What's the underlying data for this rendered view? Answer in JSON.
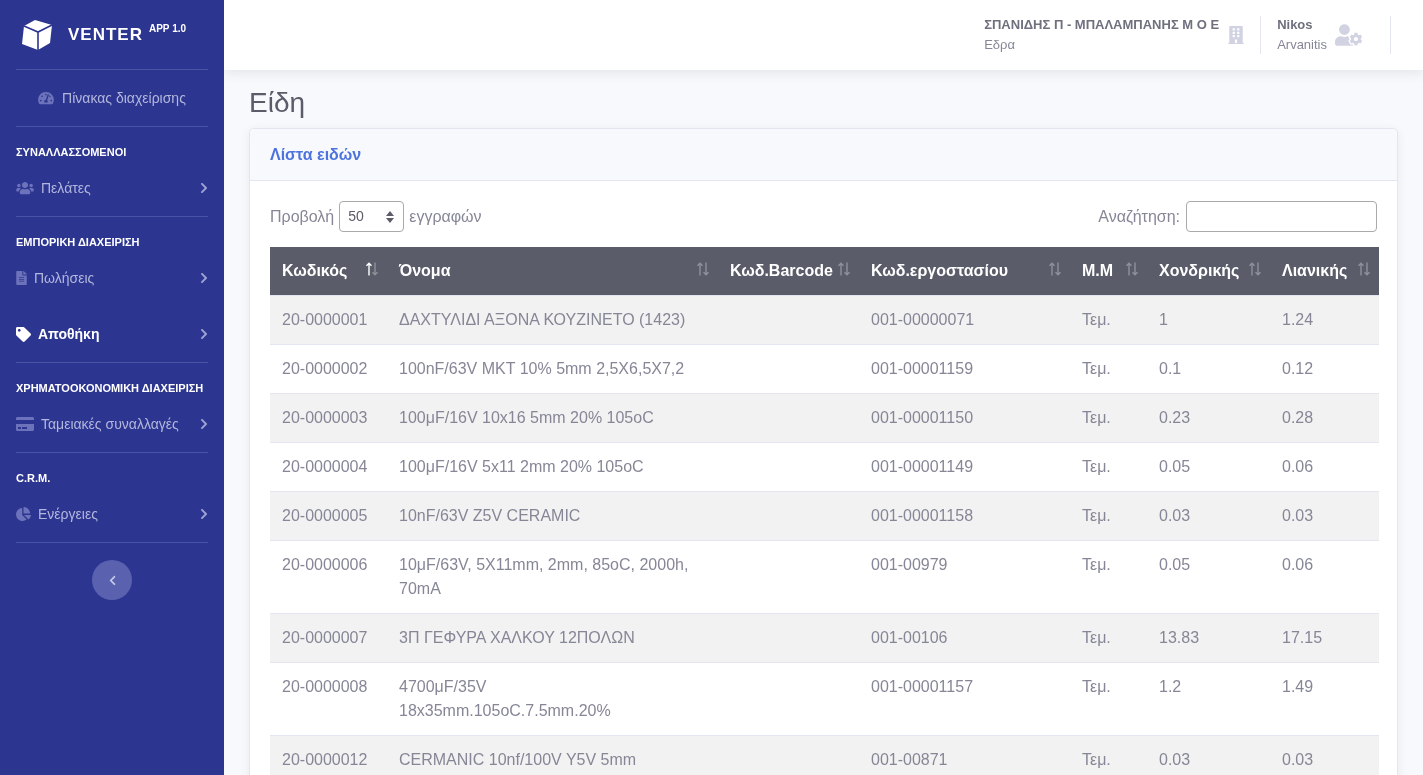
{
  "sidebar": {
    "brand": {
      "name": "VENTER",
      "version": "APP 1.0"
    },
    "dashboard": {
      "label": "Πίνακας διαχείρισης"
    },
    "sections": [
      {
        "heading": "ΣΥΝΑΛΛΑΣΣΟΜΕΝΟΙ",
        "items": [
          {
            "label": "Πελάτες",
            "selected": false
          }
        ]
      },
      {
        "heading": "ΕΜΠΟΡΙΚΗ ΔΙΑΧΕΙΡΙΣΗ",
        "items": [
          {
            "label": "Πωλήσεις",
            "selected": false
          },
          {
            "label": "Αποθήκη",
            "selected": true
          }
        ]
      },
      {
        "heading": "ΧΡΗΜΑΤΟΟΚΟΝΟΜΙΚΗ ΔΙΑΧΕΙΡΙΣΗ",
        "items": [
          {
            "label": "Ταμειακές συναλλαγές",
            "selected": false
          }
        ]
      },
      {
        "heading": "C.R.M.",
        "items": [
          {
            "label": "Ενέργειες",
            "selected": false
          }
        ]
      }
    ]
  },
  "top_bar": {
    "company": {
      "name": "ΣΠΑΝΙΔΗΣ Π - ΜΠΑΛΑΜΠΑΝΗΣ Μ Ο Ε",
      "branch": "Εδρα"
    },
    "user": {
      "first_name": "Nikos",
      "last_name": "Arvanitis"
    }
  },
  "page_title": "Είδη",
  "card": {
    "title": "Λίστα ειδών",
    "length": {
      "label_before": "Προβολή",
      "value": "50",
      "label_after": "εγγραφών"
    },
    "search": {
      "label": "Αναζήτηση:"
    }
  },
  "table": {
    "columns": [
      {
        "label": "Κωδικός",
        "sorted_ascending": true
      },
      {
        "label": "Όνομα",
        "sorted_ascending": false
      },
      {
        "label": "Κωδ.Barcode",
        "sorted_ascending": false
      },
      {
        "label": "Κωδ.εργοστασίου",
        "sorted_ascending": false
      },
      {
        "label": "Μ.Μ",
        "sorted_ascending": false
      },
      {
        "label": "Χονδρικής",
        "sorted_ascending": false
      },
      {
        "label": "Λιανικής",
        "sorted_ascending": false
      }
    ],
    "rows": [
      {
        "code": "20-0000001",
        "name": "ΔΑΧΤΥΛΙΔΙ ΑΞΟΝΑ ΚΟΥΖΙΝΕΤΟ (1423)",
        "factory_code": "001-00000071",
        "unit": "Τεμ.",
        "wholesale": "1",
        "retail": "1.24"
      },
      {
        "code": "20-0000002",
        "name": "100nF/63V MKT 10% 5mm 2,5X6,5X7,2",
        "factory_code": "001-00001159",
        "unit": "Τεμ.",
        "wholesale": "0.1",
        "retail": "0.12"
      },
      {
        "code": "20-0000003",
        "name": "100μF/16V 10x16 5mm 20% 105oC",
        "factory_code": "001-00001150",
        "unit": "Τεμ.",
        "wholesale": "0.23",
        "retail": "0.28"
      },
      {
        "code": "20-0000004",
        "name": "100μF/16V 5x11 2mm 20% 105oC",
        "factory_code": "001-00001149",
        "unit": "Τεμ.",
        "wholesale": "0.05",
        "retail": "0.06"
      },
      {
        "code": "20-0000005",
        "name": "10nF/63V Z5V CERAMIC",
        "factory_code": "001-00001158",
        "unit": "Τεμ.",
        "wholesale": "0.03",
        "retail": "0.03"
      },
      {
        "code": "20-0000006",
        "name": "10μF/63V, 5X11mm, 2mm, 85oC, 2000h, 70mA",
        "factory_code": "001-00979",
        "unit": "Τεμ.",
        "wholesale": "0.05",
        "retail": "0.06"
      },
      {
        "code": "20-0000007",
        "name": "3Π ΓΕΦΥΡΑ ΧΑΛΚΟΥ 12ΠΟΛΩΝ",
        "factory_code": "001-00106",
        "unit": "Τεμ.",
        "wholesale": "13.83",
        "retail": "17.15"
      },
      {
        "code": "20-0000008",
        "name": "4700μF/35V 18x35mm.105oC.7.5mm.20%",
        "factory_code": "001-00001157",
        "unit": "Τεμ.",
        "wholesale": "1.2",
        "retail": "1.49"
      },
      {
        "code": "20-0000012",
        "name": "CERMANIC 10nf/100V Y5V 5mm",
        "factory_code": "001-00871",
        "unit": "Τεμ.",
        "wholesale": "0.03",
        "retail": "0.03"
      }
    ]
  }
}
